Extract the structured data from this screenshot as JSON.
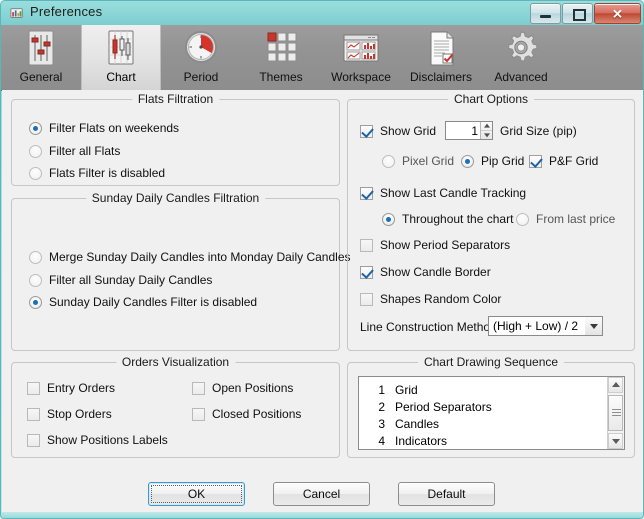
{
  "window": {
    "title": "Preferences",
    "icon": "app-chart-icon",
    "controls": {
      "minimize": "–",
      "maximize": "□",
      "close": "✕"
    }
  },
  "toolbar": {
    "items": [
      {
        "label": "General",
        "icon": "sliders-icon",
        "active": false
      },
      {
        "label": "Chart",
        "icon": "candlestick-icon",
        "active": true
      },
      {
        "label": "Period",
        "icon": "clock-icon",
        "active": false
      },
      {
        "label": "Themes",
        "icon": "grid-squares-icon",
        "active": false
      },
      {
        "label": "Workspace",
        "icon": "window-panes-icon",
        "active": false
      },
      {
        "label": "Disclaimers",
        "icon": "document-check-icon",
        "active": false
      },
      {
        "label": "Advanced",
        "icon": "gear-icon",
        "active": false
      }
    ]
  },
  "flats_filtration": {
    "title": "Flats Filtration",
    "options": [
      {
        "label": "Filter Flats on weekends",
        "selected": true
      },
      {
        "label": "Filter all Flats",
        "selected": false
      },
      {
        "label": "Flats Filter is disabled",
        "selected": false
      }
    ]
  },
  "sunday_filtration": {
    "title": "Sunday Daily Candles Filtration",
    "options": [
      {
        "label": "Merge Sunday Daily Candles into Monday Daily Candles",
        "selected": false
      },
      {
        "label": "Filter all Sunday Daily Candles",
        "selected": false
      },
      {
        "label": "Sunday Daily Candles Filter is disabled",
        "selected": true
      }
    ]
  },
  "orders_visualization": {
    "title": "Orders Visualization",
    "options": [
      {
        "label": "Entry Orders",
        "checked": false
      },
      {
        "label": "Stop Orders",
        "checked": false
      },
      {
        "label": "Show Positions Labels",
        "checked": false
      },
      {
        "label": "Open Positions",
        "checked": false
      },
      {
        "label": "Closed Positions",
        "checked": false
      }
    ]
  },
  "chart_options": {
    "title": "Chart Options",
    "show_grid": {
      "label": "Show Grid",
      "checked": true
    },
    "grid_size": {
      "value": "1",
      "label": "Grid Size (pip)"
    },
    "grid_type": [
      {
        "label": "Pixel Grid",
        "type": "radio",
        "selected": false
      },
      {
        "label": "Pip Grid",
        "type": "radio",
        "selected": true
      },
      {
        "label": "P&F Grid",
        "type": "checkbox",
        "checked": true
      }
    ],
    "show_last_candle_tracking": {
      "label": "Show Last Candle Tracking",
      "checked": true
    },
    "tracking_mode": [
      {
        "label": "Throughout the chart",
        "selected": true
      },
      {
        "label": "From last price",
        "selected": false
      }
    ],
    "show_period_separators": {
      "label": "Show Period Separators",
      "checked": false
    },
    "show_candle_border": {
      "label": "Show Candle Border",
      "checked": true
    },
    "shapes_random_color": {
      "label": "Shapes Random Color",
      "checked": false
    },
    "line_construction": {
      "label": "Line Construction Method",
      "value": "(High + Low) / 2",
      "options": [
        "(High + Low) / 2"
      ]
    }
  },
  "chart_drawing_sequence": {
    "title": "Chart Drawing Sequence",
    "items": [
      {
        "num": "1",
        "label": "Grid"
      },
      {
        "num": "2",
        "label": "Period Separators"
      },
      {
        "num": "3",
        "label": "Candles"
      },
      {
        "num": "4",
        "label": "Indicators"
      }
    ]
  },
  "footer": {
    "ok": "OK",
    "cancel": "Cancel",
    "default": "Default"
  },
  "colors": {
    "titlebar": "#8ad5d6",
    "toolbar": "#949494",
    "dialog_bg": "#f0f0f0",
    "accent": "#1a6fb5",
    "close_button": "#bf4633",
    "check_mark": "#1b63a6"
  }
}
